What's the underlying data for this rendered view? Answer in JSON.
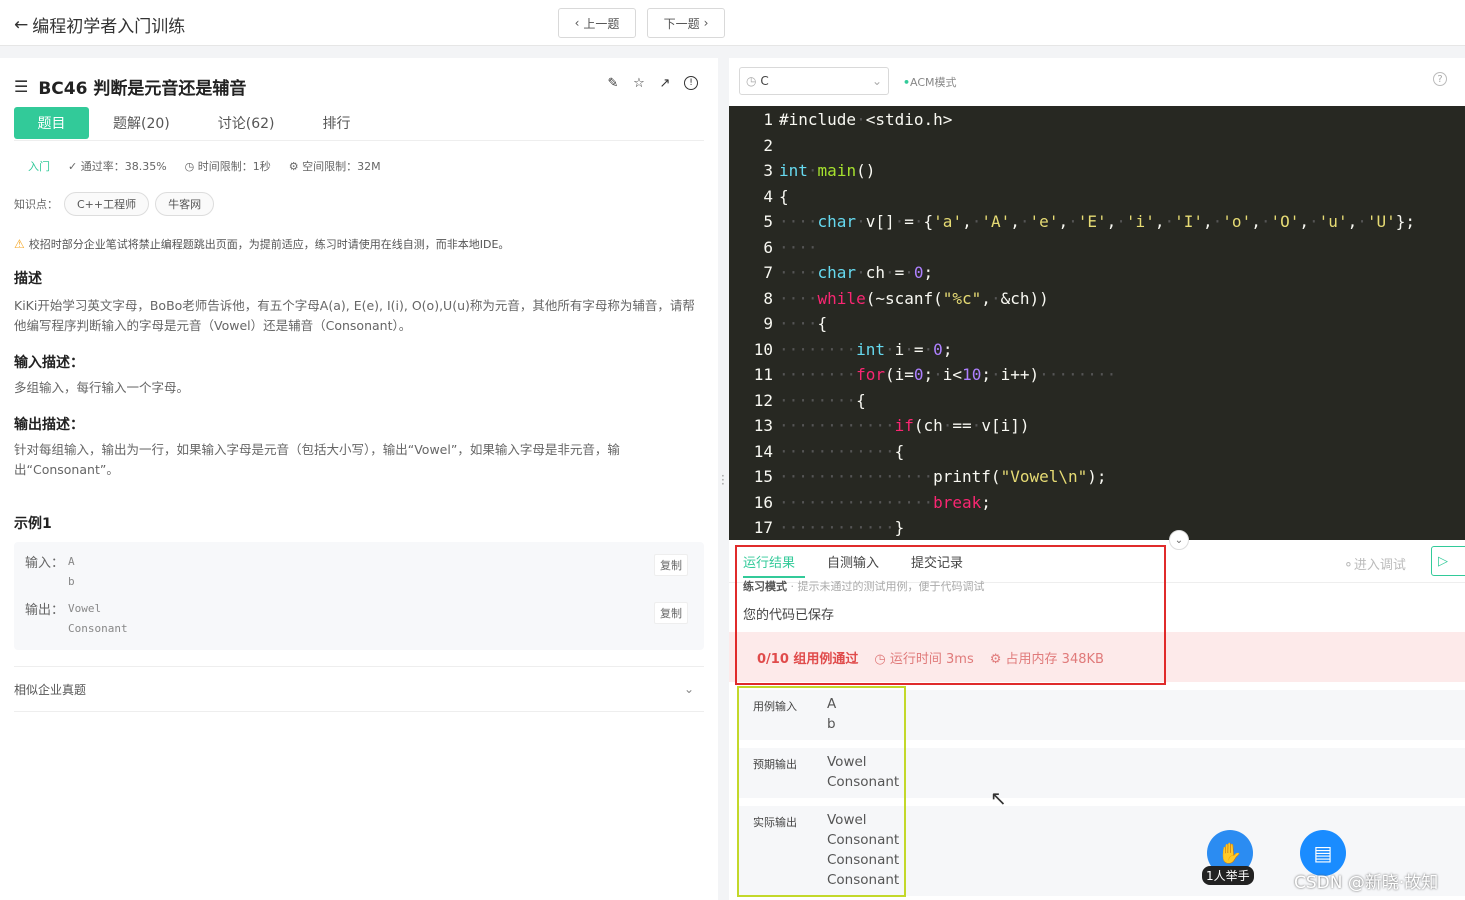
{
  "header": {
    "back_label": "编程初学者入门训练",
    "prev_label": "上一题",
    "next_label": "下一题"
  },
  "problem": {
    "title": "BC46  判断是元音还是辅音",
    "tabs": [
      "题目",
      "题解(20)",
      "讨论(62)",
      "排行"
    ],
    "level": "入门",
    "pass_rate": "通过率：38.35%",
    "time_limit": "时间限制：1秒",
    "space_limit": "空间限制：32M",
    "knowledge_label": "知识点：",
    "knowledge_tags": [
      "C++工程师",
      "牛客网"
    ],
    "warning": "校招时部分企业笔试将禁止编程题跳出页面，为提前适应，练习时请使用在线自测，而非本地IDE。",
    "desc_title": "描述",
    "desc_text": "KiKi开始学习英文字母，BoBo老师告诉他，有五个字母A(a), E(e), I(i), O(o),U(u)称为元音，其他所有字母称为辅音，请帮他编写程序判断输入的字母是元音（Vowel）还是辅音（Consonant）。",
    "input_title": "输入描述：",
    "input_text": "多组输入，每行输入一个字母。",
    "output_title": "输出描述：",
    "output_text": "针对每组输入，输出为一行，如果输入字母是元音（包括大小写），输出“Vowel”，如果输入字母是非元音，输出“Consonant”。",
    "example_title": "示例1",
    "example_input_label": "输入：",
    "example_input_lines": [
      "A",
      "b"
    ],
    "example_output_label": "输出：",
    "example_output_lines": [
      "Vowel",
      "Consonant"
    ],
    "copy_label": "复制",
    "similar_label": "相似企业真题"
  },
  "editor": {
    "language": "C",
    "mode": "ACM模式",
    "code": [
      "#include <stdio.h>",
      "",
      "int main()",
      "{",
      "    char v[] = {'a', 'A', 'e', 'E', 'i', 'I', 'o', 'O', 'u', 'U'};",
      "    ",
      "    char ch = 0;",
      "    while(~scanf(\"%c\", &ch))",
      "    {",
      "        int i = 0;",
      "        for(i=0; i<10; i++)",
      "        {",
      "            if(ch == v[i])",
      "            {",
      "                printf(\"Vowel\\n\");",
      "                break;",
      "            }"
    ]
  },
  "result": {
    "tabs": [
      "运行结果",
      "自测输入",
      "提交记录"
    ],
    "debug_label": "进入调试",
    "practice_mode": "练习模式",
    "practice_hint": "提示未通过的测试用例，便于代码调试",
    "saved_msg": "您的代码已保存",
    "pass_count": "0/10 组用例通过",
    "run_time": "运行时间 3ms",
    "memory": "占用内存 348KB",
    "case_input_label": "用例输入",
    "case_input": [
      "A",
      "b"
    ],
    "expected_label": "预期输出",
    "expected": [
      "Vowel",
      "Consonant"
    ],
    "actual_label": "实际输出",
    "actual": [
      "Vowel",
      "Consonant",
      "Consonant",
      "Consonant"
    ]
  },
  "overlay": {
    "hand_label": "1人举手",
    "watermark": "CSDN @新晓·故知"
  },
  "colors": {
    "accent": "#32ca99",
    "editor_bg": "#272822",
    "fail_bg": "#fdeaea",
    "fail_text": "#e04b4b"
  }
}
